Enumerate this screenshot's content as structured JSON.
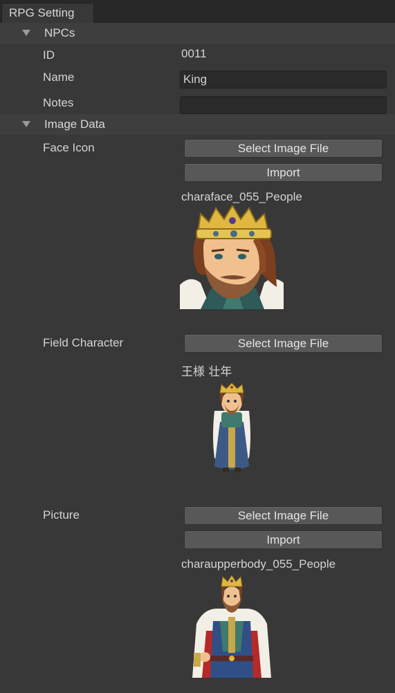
{
  "window": {
    "tab_title": "RPG Setting"
  },
  "npcs": {
    "header": "NPCs",
    "id_label": "ID",
    "id_value": "0011",
    "name_label": "Name",
    "name_value": "King",
    "notes_label": "Notes",
    "notes_value": ""
  },
  "image_data": {
    "header": "Image Data",
    "face_icon": {
      "label": "Face Icon",
      "select_button": "Select Image File",
      "import_button": "Import",
      "file_name": "charaface_055_People"
    },
    "field_character": {
      "label": "Field Character",
      "select_button": "Select Image File",
      "file_name": "王様 壮年"
    },
    "picture": {
      "label": "Picture",
      "select_button": "Select Image File",
      "import_button": "Import",
      "file_name": "charaupperbody_055_People"
    }
  },
  "colors": {
    "background": "#383838",
    "tab_bar": "#282828",
    "foldout_header": "#3e3e3e",
    "button": "#585858",
    "text_field": "#2a2a2a",
    "text": "#d4d4d4"
  },
  "icons": [
    "foldout-arrow-icon",
    "foldout-arrow-icon"
  ]
}
